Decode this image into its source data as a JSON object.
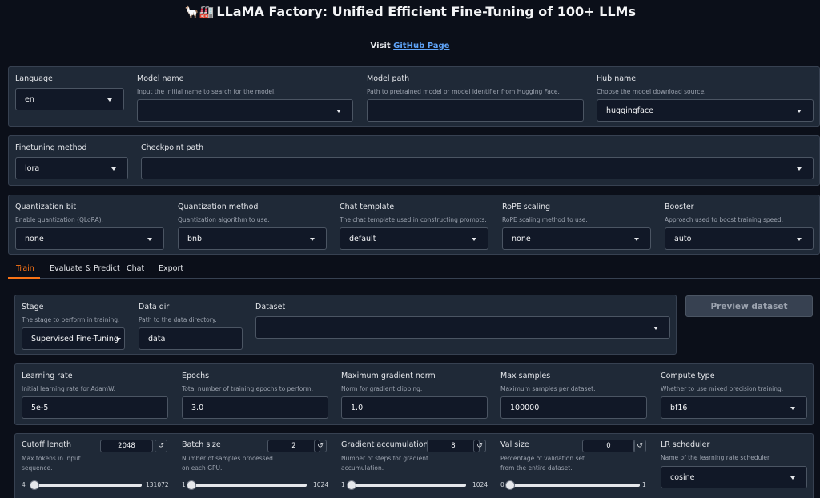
{
  "header": {
    "emoji": "🦙🏭",
    "title": "LLaMA Factory: Unified Efficient Fine-Tuning of 100+ LLMs",
    "visit_prefix": "Visit ",
    "github_link": "GitHub Page"
  },
  "model": {
    "language": {
      "label": "Language",
      "value": "en"
    },
    "model_name": {
      "label": "Model name",
      "info": "Input the initial name to search for the model.",
      "value": ""
    },
    "model_path": {
      "label": "Model path",
      "info": "Path to pretrained model or model identifier from Hugging Face.",
      "value": ""
    },
    "hub_name": {
      "label": "Hub name",
      "info": "Choose the model download source.",
      "value": "huggingface"
    }
  },
  "finetune": {
    "method": {
      "label": "Finetuning method",
      "value": "lora"
    },
    "checkpoint": {
      "label": "Checkpoint path",
      "value": ""
    }
  },
  "advanced": {
    "quant_bit": {
      "label": "Quantization bit",
      "info": "Enable quantization (QLoRA).",
      "value": "none"
    },
    "quant_method": {
      "label": "Quantization method",
      "info": "Quantization algorithm to use.",
      "value": "bnb"
    },
    "chat_template": {
      "label": "Chat template",
      "info": "The chat template used in constructing prompts.",
      "value": "default"
    },
    "rope": {
      "label": "RoPE scaling",
      "info": "RoPE scaling method to use.",
      "value": "none"
    },
    "booster": {
      "label": "Booster",
      "info": "Approach used to boost training speed.",
      "value": "auto"
    }
  },
  "tabs": [
    "Train",
    "Evaluate & Predict",
    "Chat",
    "Export"
  ],
  "train": {
    "stage": {
      "label": "Stage",
      "info": "The stage to perform in training.",
      "value": "Supervised Fine-Tuning"
    },
    "data_dir": {
      "label": "Data dir",
      "info": "Path to the data directory.",
      "value": "data"
    },
    "dataset": {
      "label": "Dataset",
      "value": ""
    },
    "preview_button": "Preview dataset",
    "learning_rate": {
      "label": "Learning rate",
      "info": "Initial learning rate for AdamW.",
      "value": "5e-5"
    },
    "epochs": {
      "label": "Epochs",
      "info": "Total number of training epochs to perform.",
      "value": "3.0"
    },
    "max_grad_norm": {
      "label": "Maximum gradient norm",
      "info": "Norm for gradient clipping.",
      "value": "1.0"
    },
    "max_samples": {
      "label": "Max samples",
      "info": "Maximum samples per dataset.",
      "value": "100000"
    },
    "compute_type": {
      "label": "Compute type",
      "info": "Whether to use mixed precision training.",
      "value": "bf16"
    },
    "cutoff_len": {
      "label": "Cutoff length",
      "info1": "Max tokens in input",
      "info2": "sequence.",
      "value": "2048",
      "min": "4",
      "max": "131072",
      "fraction": 0.015
    },
    "batch_size": {
      "label": "Batch size",
      "info1": "Number of samples processed",
      "info2": "on each GPU.",
      "value": "2",
      "min": "1",
      "max": "1024",
      "fraction": 0.001
    },
    "grad_accum": {
      "label": "Gradient accumulation",
      "info1": "Number of steps for gradient",
      "info2": "accumulation.",
      "value": "8",
      "min": "1",
      "max": "1024",
      "fraction": 0.007
    },
    "val_size": {
      "label": "Val size",
      "info1": "Percentage of validation set",
      "info2": "from the entire dataset.",
      "value": "0",
      "min": "0",
      "max": "1",
      "fraction": 0
    },
    "lr_scheduler": {
      "label": "LR scheduler",
      "info": "Name of the learning rate scheduler.",
      "value": "cosine"
    }
  },
  "icons": {
    "reset": "↺",
    "dropdown": "chevron-down"
  }
}
